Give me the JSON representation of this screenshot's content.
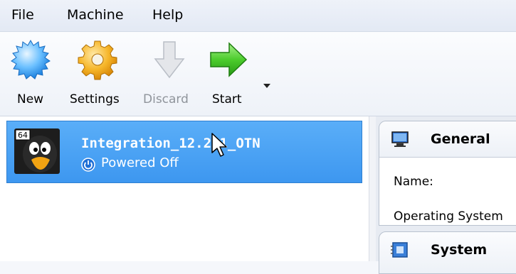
{
  "menu": {
    "items": [
      {
        "label": "File"
      },
      {
        "label": "Machine"
      },
      {
        "label": "Help"
      }
    ]
  },
  "toolbar": {
    "new_label": "New",
    "settings_label": "Settings",
    "discard_label": "Discard",
    "start_label": "Start",
    "icons": {
      "new": "new-vm-icon",
      "settings": "settings-gear-icon",
      "discard": "discard-arrow-icon",
      "start": "start-arrow-icon"
    }
  },
  "vm_list": {
    "items": [
      {
        "name": "Integration_12.2.1_OTN",
        "state": "Powered Off",
        "os_badge": "64",
        "selected": true
      }
    ]
  },
  "details": {
    "general": {
      "title": "General",
      "name_label": "Name:",
      "os_label": "Operating System"
    },
    "system": {
      "title": "System"
    }
  },
  "colors": {
    "selection": "#4aa3f5",
    "start_green": "#3fbf2a",
    "settings_orange": "#f0a51c",
    "new_blue": "#3aa0f0"
  }
}
